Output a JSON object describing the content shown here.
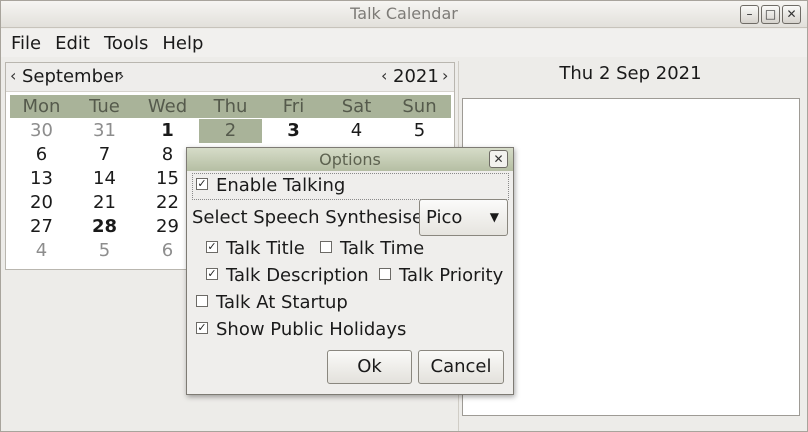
{
  "window": {
    "title": "Talk Calendar",
    "controls": [
      "–",
      "□",
      "✕"
    ]
  },
  "menu": [
    "File",
    "Edit",
    "Tools",
    "Help"
  ],
  "calendar": {
    "month": "September",
    "year": "2021",
    "weekdays": [
      "Mon",
      "Tue",
      "Wed",
      "Thu",
      "Fri",
      "Sat",
      "Sun"
    ],
    "rows": [
      [
        {
          "d": "30",
          "s": "dim"
        },
        {
          "d": "31",
          "s": "dim"
        },
        {
          "d": "1",
          "s": "bold"
        },
        {
          "d": "2",
          "s": "sel"
        },
        {
          "d": "3",
          "s": "bold"
        },
        {
          "d": "4",
          "s": ""
        },
        {
          "d": "5",
          "s": ""
        }
      ],
      [
        {
          "d": "6",
          "s": ""
        },
        {
          "d": "7",
          "s": ""
        },
        {
          "d": "8",
          "s": ""
        },
        {
          "d": "",
          "s": ""
        },
        {
          "d": "",
          "s": ""
        },
        {
          "d": "",
          "s": ""
        },
        {
          "d": "",
          "s": ""
        }
      ],
      [
        {
          "d": "13",
          "s": ""
        },
        {
          "d": "14",
          "s": ""
        },
        {
          "d": "15",
          "s": ""
        },
        {
          "d": "",
          "s": ""
        },
        {
          "d": "",
          "s": ""
        },
        {
          "d": "",
          "s": ""
        },
        {
          "d": "",
          "s": ""
        }
      ],
      [
        {
          "d": "20",
          "s": ""
        },
        {
          "d": "21",
          "s": ""
        },
        {
          "d": "22",
          "s": ""
        },
        {
          "d": "",
          "s": ""
        },
        {
          "d": "",
          "s": ""
        },
        {
          "d": "",
          "s": ""
        },
        {
          "d": "",
          "s": ""
        }
      ],
      [
        {
          "d": "27",
          "s": ""
        },
        {
          "d": "28",
          "s": "bold"
        },
        {
          "d": "29",
          "s": ""
        },
        {
          "d": "",
          "s": ""
        },
        {
          "d": "",
          "s": ""
        },
        {
          "d": "",
          "s": ""
        },
        {
          "d": "",
          "s": ""
        }
      ],
      [
        {
          "d": "4",
          "s": "dim"
        },
        {
          "d": "5",
          "s": "dim"
        },
        {
          "d": "6",
          "s": "dim"
        },
        {
          "d": "",
          "s": ""
        },
        {
          "d": "",
          "s": ""
        },
        {
          "d": "",
          "s": ""
        },
        {
          "d": "",
          "s": ""
        }
      ]
    ]
  },
  "selected_date": "Thu  2 Sep 2021",
  "options": {
    "title": "Options",
    "enable_talking": "Enable Talking",
    "synth_label": "Select Speech Synthesiser:",
    "synth_value": "Pico",
    "talk_title": "Talk Title",
    "talk_time": "Talk Time",
    "talk_description": "Talk Description",
    "talk_priority": "Talk Priority",
    "talk_at_startup": "Talk At Startup",
    "show_public_holidays": "Show Public Holidays",
    "ok": "Ok",
    "cancel": "Cancel",
    "checked": {
      "enable_talking": true,
      "talk_title": true,
      "talk_time": false,
      "talk_description": true,
      "talk_priority": false,
      "talk_at_startup": false,
      "show_public_holidays": true
    }
  }
}
